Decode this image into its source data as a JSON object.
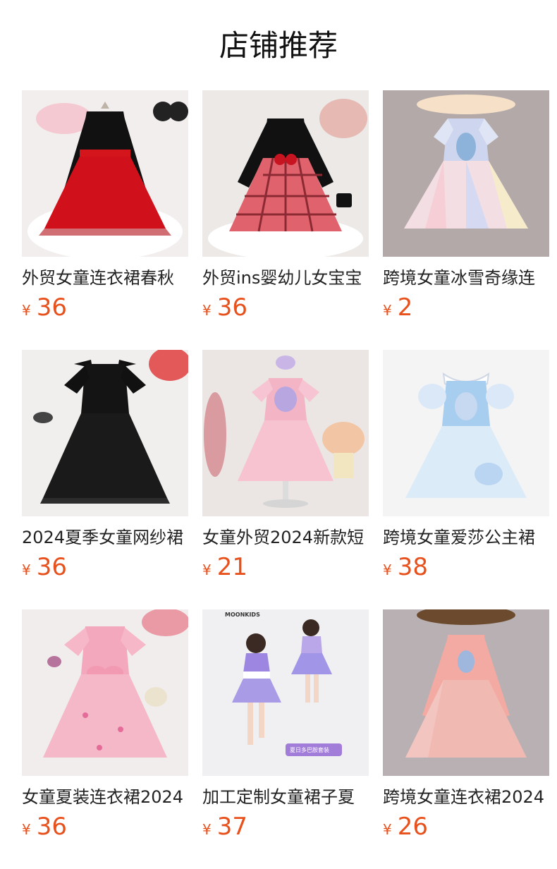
{
  "header": {
    "title": "店铺推荐"
  },
  "colors": {
    "price": "#e8511c",
    "title": "#111111",
    "name": "#222222"
  },
  "products": [
    {
      "name": "外贸女童连衣裙春秋",
      "currency": "¥",
      "price": "36",
      "image": "black-red-polka-tulle-dress"
    },
    {
      "name": "外贸ins婴幼儿女宝宝",
      "currency": "¥",
      "price": "36",
      "image": "black-red-plaid-tulle-dress"
    },
    {
      "name": "跨境女童冰雪奇缘连",
      "currency": "¥",
      "price": "2",
      "image": "elsa-rainbow-tulle-dress"
    },
    {
      "name": "2024夏季女童网纱裙",
      "currency": "¥",
      "price": "36",
      "image": "black-flutter-tulle-dress"
    },
    {
      "name": "女童外贸2024新款短",
      "currency": "¥",
      "price": "21",
      "image": "pink-sequin-tulle-dress-on-stand"
    },
    {
      "name": "跨境女童爱莎公主裙",
      "currency": "¥",
      "price": "38",
      "image": "blue-elsa-princess-dress"
    },
    {
      "name": "女童夏装连衣裙2024",
      "currency": "¥",
      "price": "36",
      "image": "pink-butterfly-tulle-dress"
    },
    {
      "name": "加工定制女童裙子夏",
      "currency": "¥",
      "price": "37",
      "image": "girls-purple-gradient-outfit"
    },
    {
      "name": "跨境女童连衣裙2024",
      "currency": "¥",
      "price": "26",
      "image": "pink-long-sleeve-elsa-dress"
    }
  ],
  "ad_text": {
    "brand": "MOONKIDS",
    "badge": "夏日多巴胺套装"
  }
}
